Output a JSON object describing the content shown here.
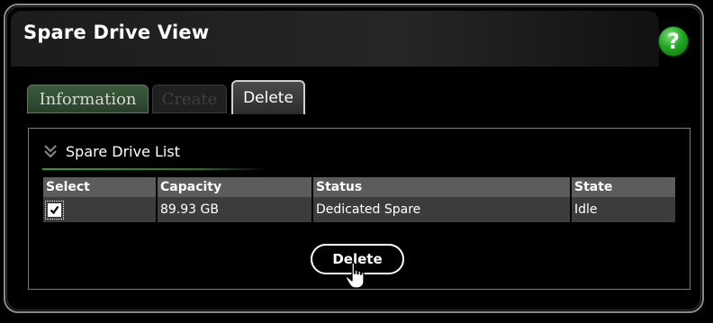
{
  "window": {
    "title": "Spare Drive View",
    "help_label": "?"
  },
  "tabs": [
    {
      "label": "Information",
      "state": "inactive"
    },
    {
      "label": "Create",
      "state": "disabled"
    },
    {
      "label": "Delete",
      "state": "active"
    }
  ],
  "section": {
    "title": "Spare Drive List",
    "icon": "chevron-down-double-icon"
  },
  "table": {
    "columns": [
      "Select",
      "Capacity",
      "Status",
      "State"
    ],
    "rows": [
      {
        "selected": true,
        "capacity": "89.93 GB",
        "status": "Dedicated Spare",
        "state": "Idle"
      }
    ]
  },
  "actions": {
    "delete_label": "Delete"
  },
  "colors": {
    "help_green": "#23a823",
    "section_rule_green": "#3f9b3f",
    "header_gray": "#5c5c5c",
    "row_gray": "#3c3c3c"
  }
}
